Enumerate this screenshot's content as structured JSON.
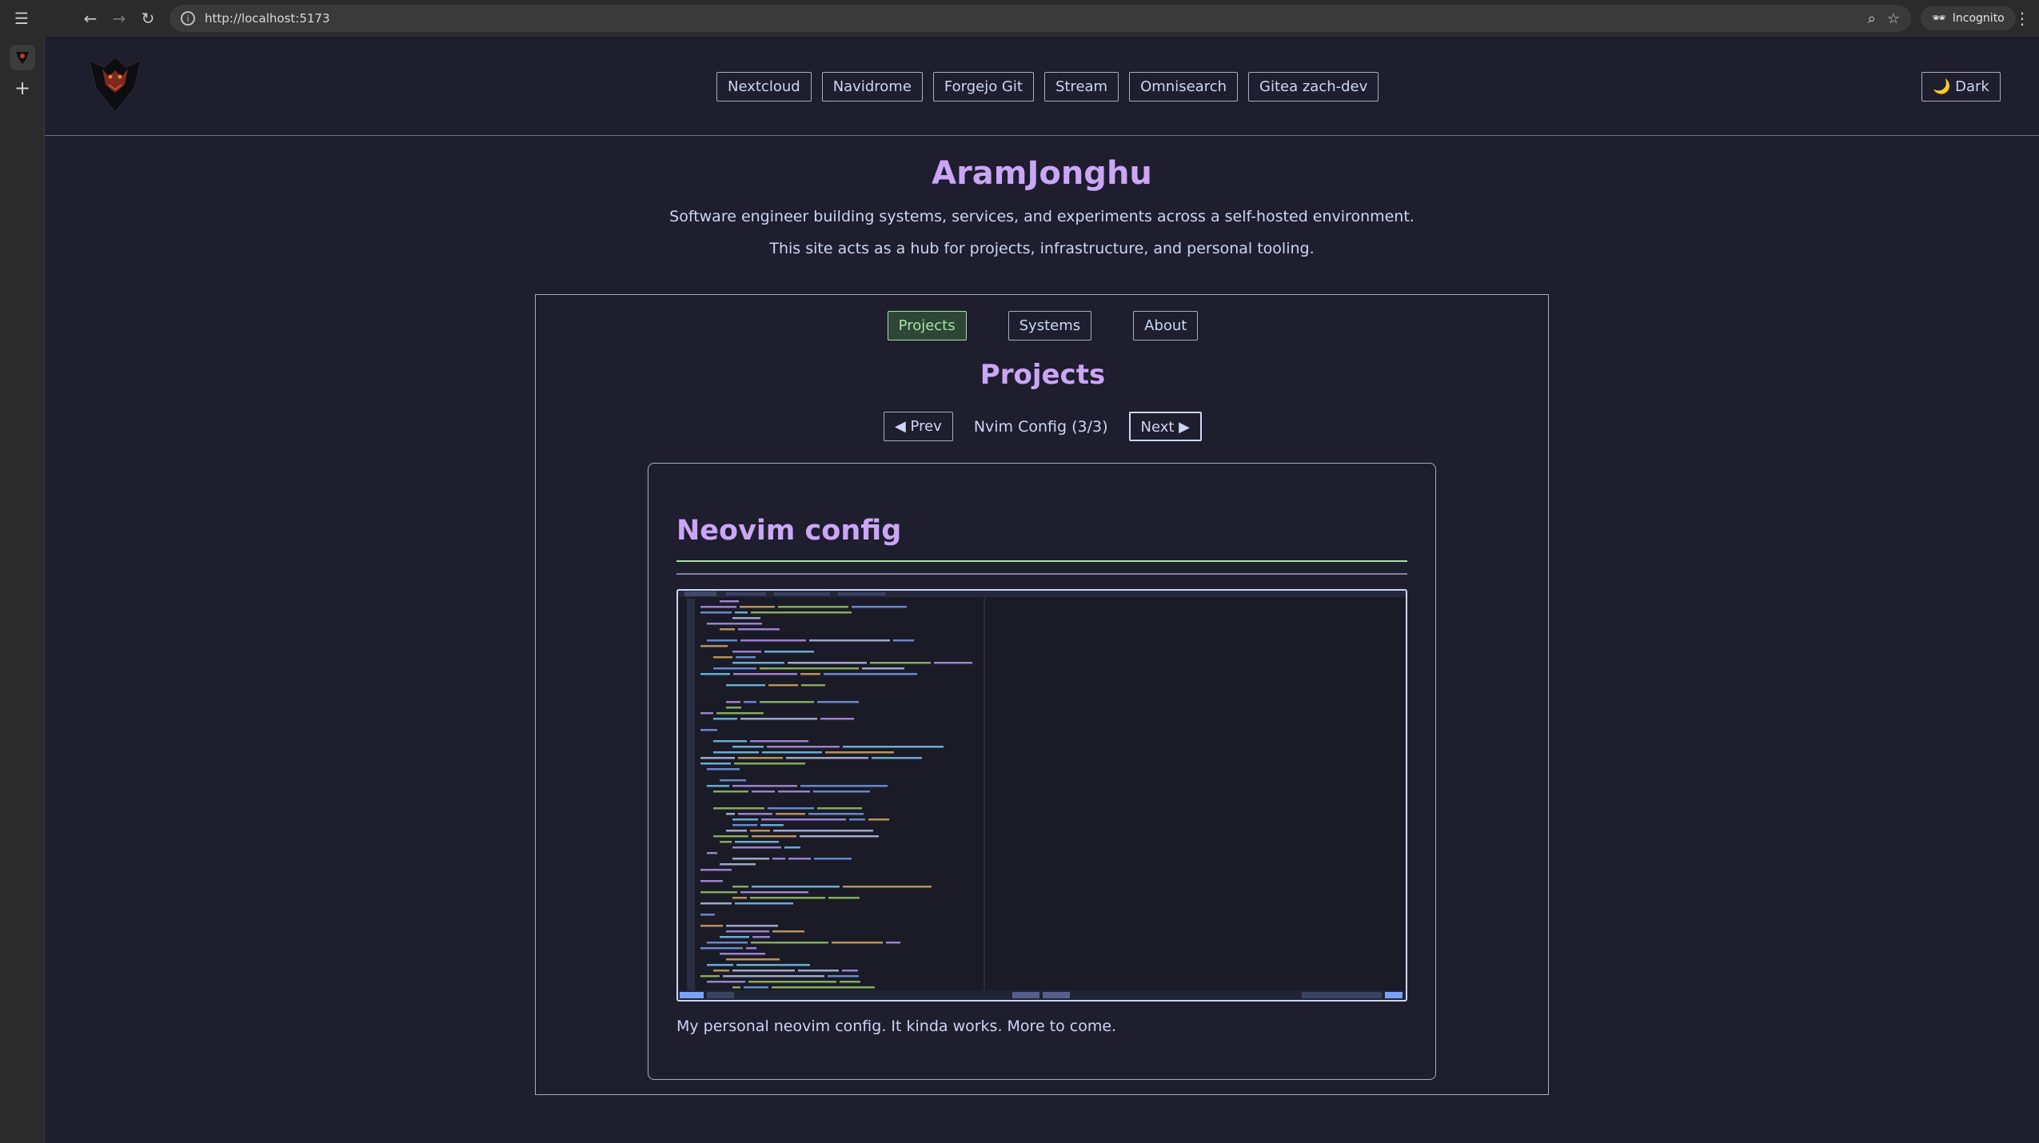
{
  "browser": {
    "url": "http://localhost:5173",
    "incognito_label": "Incognito",
    "icons": [
      "sidebar-icon",
      "back-icon",
      "forward-icon",
      "reload-icon",
      "site-info-icon",
      "zoom-icon",
      "bookmark-star-icon",
      "incognito-icon",
      "menu-dots-icon",
      "new-tab-icon"
    ]
  },
  "header": {
    "nav_links": [
      "Nextcloud",
      "Navidrome",
      "Forgejo Git",
      "Stream",
      "Omnisearch",
      "Gitea zach-dev"
    ],
    "theme_button": "🌙 Dark"
  },
  "hero": {
    "title": "AramJonghu",
    "line1": "Software engineer building systems, services, and experiments across a self-hosted environment.",
    "line2": "This site acts as a hub for projects, infrastructure, and personal tooling."
  },
  "tabs": {
    "items": [
      "Projects",
      "Systems",
      "About"
    ],
    "active": "Projects"
  },
  "section": {
    "title": "Projects",
    "prev_label": "◀ Prev",
    "next_label": "Next ▶",
    "pager_label": "Nvim Config (3/3)"
  },
  "card": {
    "title": "Neovim config",
    "description": "My personal neovim config. It kinda works. More to come."
  },
  "colors": {
    "background": "#1e1e2e",
    "accent_purple": "#cba6f7",
    "accent_green": "#a6e3a1",
    "text": "#cdd6f4",
    "border": "#a6adc8"
  }
}
